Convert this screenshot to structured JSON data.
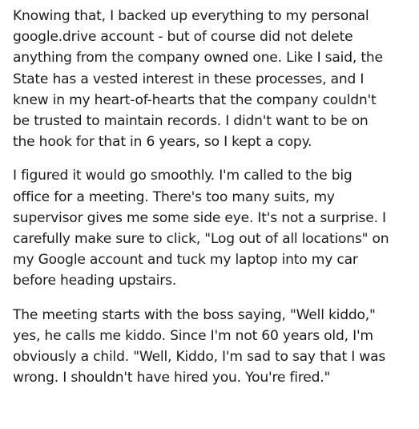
{
  "post": {
    "paragraphs": [
      {
        "lines": [
          "Knowing that, I backed up everything to my personal",
          "google.drive account - but of course did not delete",
          "anything from the company owned one. Like I said, the",
          "State has a vested interest in these processes, and I",
          "knew in my heart-of-hearts that the company couldn't",
          "be trusted to maintain records. I didn't want to be on",
          "the hook for that in 6 years, so I kept a copy."
        ]
      },
      {
        "lines": [
          "I figured it would go smoothly. I'm called to the big",
          "office for a meeting. There's too many suits, my",
          "supervisor gives me some side eye. It's not a surprise. I",
          "carefully make sure to click, \"Log out of all locations\" on",
          "my Google account and tuck my laptop into my car",
          "before heading upstairs."
        ]
      },
      {
        "lines": [
          "The meeting starts with the boss saying, \"Well kiddo,\"",
          "yes, he calls me kiddo. Since I'm not 60 years old, I'm",
          "obviously a child. \"Well, Kiddo, I'm sad to say that I was",
          "wrong. I shouldn't have hired you. You're fired.\""
        ]
      }
    ]
  }
}
